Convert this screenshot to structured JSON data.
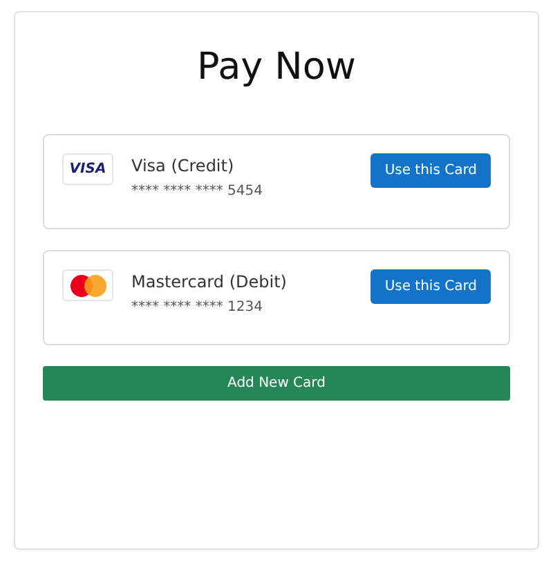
{
  "title": "Pay Now",
  "cards": [
    {
      "kind": "visa",
      "logo_text": "VISA",
      "name": "Visa (Credit)",
      "number": "**** **** **** 5454",
      "button": "Use this Card"
    },
    {
      "kind": "mastercard",
      "name": "Mastercard (Debit)",
      "number": "**** **** **** 1234",
      "button": "Use this Card"
    }
  ],
  "add_button": "Add New Card"
}
